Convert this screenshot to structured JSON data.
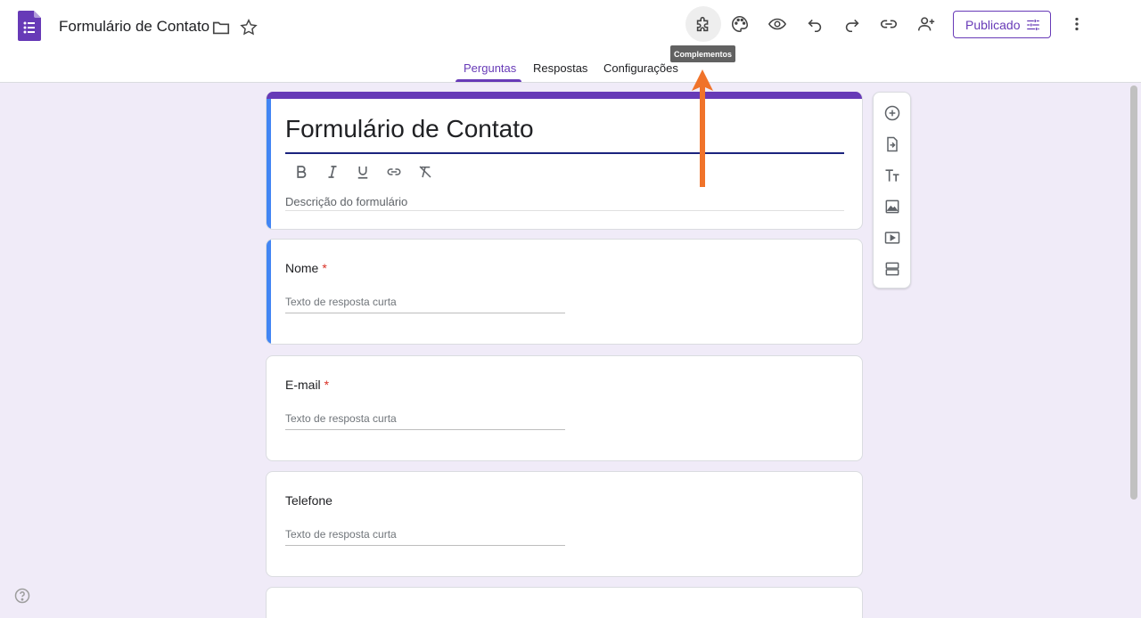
{
  "header": {
    "doc_title": "Formulário de Contato",
    "publish_label": "Publicado"
  },
  "tooltip": "Complementos",
  "tabs": [
    {
      "label": "Perguntas",
      "active": true
    },
    {
      "label": "Respostas",
      "active": false
    },
    {
      "label": "Configurações",
      "active": false
    }
  ],
  "form": {
    "title": "Formulário de Contato",
    "description_placeholder": "Descrição do formulário"
  },
  "questions": [
    {
      "label": "Nome",
      "required_mark": "*",
      "answer_placeholder": "Texto de resposta curta"
    },
    {
      "label": "E-mail",
      "required_mark": "*",
      "answer_placeholder": "Texto de resposta curta"
    },
    {
      "label": "Telefone",
      "answer_placeholder": "Texto de resposta curta"
    }
  ],
  "colors": {
    "brand": "#673ab7",
    "accent_blue": "#4285f4",
    "background": "#f0ebf8",
    "annotation_arrow": "#f0732a"
  },
  "icons": {
    "toolbar": [
      "puzzle-icon",
      "palette-icon",
      "eye-icon",
      "undo-icon",
      "redo-icon",
      "link-icon",
      "add-person-icon",
      "more-vert-icon"
    ],
    "side": [
      "add-circle-icon",
      "import-icon",
      "text-icon",
      "image-icon",
      "video-icon",
      "section-icon"
    ]
  }
}
